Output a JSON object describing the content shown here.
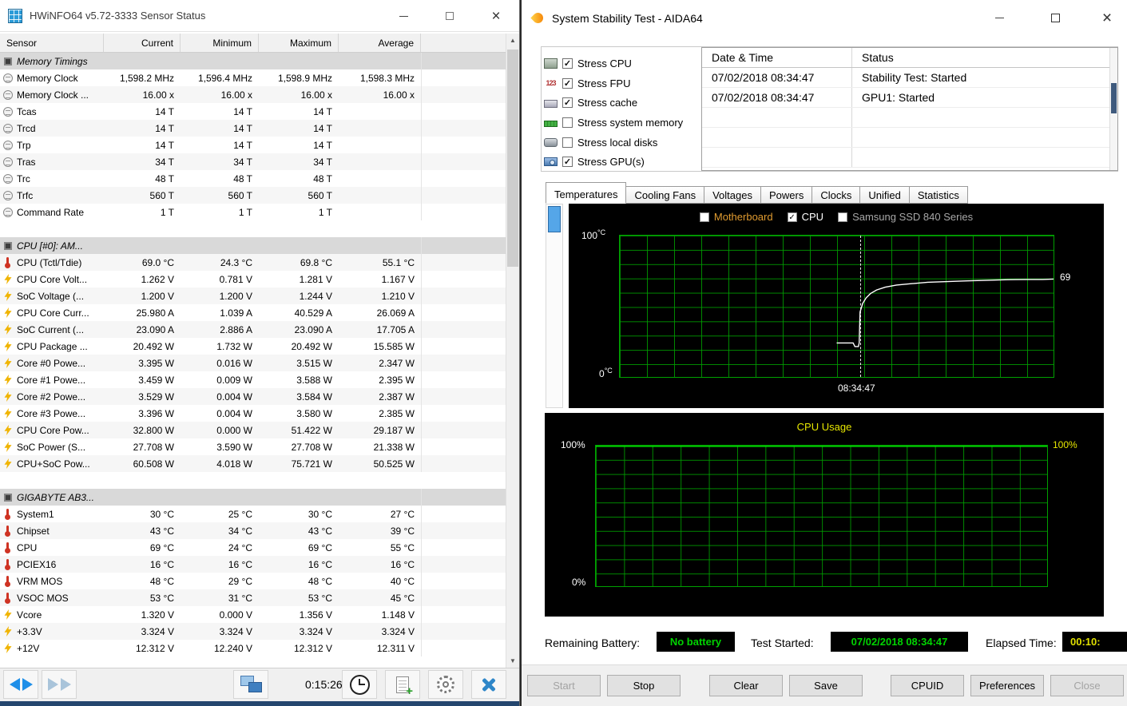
{
  "hwinfo": {
    "title": "HWiNFO64 v5.72-3333 Sensor Status",
    "columns": [
      "Sensor",
      "Current",
      "Minimum",
      "Maximum",
      "Average"
    ],
    "rows": [
      {
        "kind": "section",
        "icon": "chip-icon",
        "label": "Memory Timings"
      },
      {
        "kind": "data",
        "icon": "timing-icon",
        "label": "Memory Clock",
        "values": [
          "1,598.2 MHz",
          "1,596.4 MHz",
          "1,598.9 MHz",
          "1,598.3 MHz"
        ]
      },
      {
        "kind": "data",
        "icon": "timing-icon",
        "label": "Memory Clock ...",
        "values": [
          "16.00 x",
          "16.00 x",
          "16.00 x",
          "16.00 x"
        ]
      },
      {
        "kind": "data",
        "icon": "timing-icon",
        "label": "Tcas",
        "values": [
          "14 T",
          "14 T",
          "14 T",
          ""
        ]
      },
      {
        "kind": "data",
        "icon": "timing-icon",
        "label": "Trcd",
        "values": [
          "14 T",
          "14 T",
          "14 T",
          ""
        ]
      },
      {
        "kind": "data",
        "icon": "timing-icon",
        "label": "Trp",
        "values": [
          "14 T",
          "14 T",
          "14 T",
          ""
        ]
      },
      {
        "kind": "data",
        "icon": "timing-icon",
        "label": "Tras",
        "values": [
          "34 T",
          "34 T",
          "34 T",
          ""
        ]
      },
      {
        "kind": "data",
        "icon": "timing-icon",
        "label": "Trc",
        "values": [
          "48 T",
          "48 T",
          "48 T",
          ""
        ]
      },
      {
        "kind": "data",
        "icon": "timing-icon",
        "label": "Trfc",
        "values": [
          "560 T",
          "560 T",
          "560 T",
          ""
        ]
      },
      {
        "kind": "data",
        "icon": "timing-icon",
        "label": "Command Rate",
        "values": [
          "1 T",
          "1 T",
          "1 T",
          ""
        ]
      },
      {
        "kind": "spacer"
      },
      {
        "kind": "section",
        "icon": "chip-icon",
        "label": "CPU [#0]: AM..."
      },
      {
        "kind": "data",
        "icon": "temp-icon",
        "label": "CPU (Tctl/Tdie)",
        "values": [
          "69.0 °C",
          "24.3 °C",
          "69.8 °C",
          "55.1 °C"
        ]
      },
      {
        "kind": "data",
        "icon": "power-icon",
        "label": "CPU Core Volt...",
        "values": [
          "1.262 V",
          "0.781 V",
          "1.281 V",
          "1.167 V"
        ]
      },
      {
        "kind": "data",
        "icon": "power-icon",
        "label": "SoC Voltage (...",
        "values": [
          "1.200 V",
          "1.200 V",
          "1.244 V",
          "1.210 V"
        ]
      },
      {
        "kind": "data",
        "icon": "power-icon",
        "label": "CPU Core Curr...",
        "values": [
          "25.980 A",
          "1.039 A",
          "40.529 A",
          "26.069 A"
        ]
      },
      {
        "kind": "data",
        "icon": "power-icon",
        "label": "SoC Current (...",
        "values": [
          "23.090 A",
          "2.886 A",
          "23.090 A",
          "17.705 A"
        ]
      },
      {
        "kind": "data",
        "icon": "power-icon",
        "label": "CPU Package ...",
        "values": [
          "20.492 W",
          "1.732 W",
          "20.492 W",
          "15.585 W"
        ]
      },
      {
        "kind": "data",
        "icon": "power-icon",
        "label": "Core #0 Powe...",
        "values": [
          "3.395 W",
          "0.016 W",
          "3.515 W",
          "2.347 W"
        ]
      },
      {
        "kind": "data",
        "icon": "power-icon",
        "label": "Core #1 Powe...",
        "values": [
          "3.459 W",
          "0.009 W",
          "3.588 W",
          "2.395 W"
        ]
      },
      {
        "kind": "data",
        "icon": "power-icon",
        "label": "Core #2 Powe...",
        "values": [
          "3.529 W",
          "0.004 W",
          "3.584 W",
          "2.387 W"
        ]
      },
      {
        "kind": "data",
        "icon": "power-icon",
        "label": "Core #3 Powe...",
        "values": [
          "3.396 W",
          "0.004 W",
          "3.580 W",
          "2.385 W"
        ]
      },
      {
        "kind": "data",
        "icon": "power-icon",
        "label": "CPU Core Pow...",
        "values": [
          "32.800 W",
          "0.000 W",
          "51.422 W",
          "29.187 W"
        ]
      },
      {
        "kind": "data",
        "icon": "power-icon",
        "label": "SoC Power (S...",
        "values": [
          "27.708 W",
          "3.590 W",
          "27.708 W",
          "21.338 W"
        ]
      },
      {
        "kind": "data",
        "icon": "power-icon",
        "label": "CPU+SoC Pow...",
        "values": [
          "60.508 W",
          "4.018 W",
          "75.721 W",
          "50.525 W"
        ]
      },
      {
        "kind": "spacer"
      },
      {
        "kind": "section",
        "icon": "chip-icon",
        "label": "GIGABYTE AB3..."
      },
      {
        "kind": "data",
        "icon": "temp-icon",
        "label": "System1",
        "values": [
          "30 °C",
          "25 °C",
          "30 °C",
          "27 °C"
        ]
      },
      {
        "kind": "data",
        "icon": "temp-icon",
        "label": "Chipset",
        "values": [
          "43 °C",
          "34 °C",
          "43 °C",
          "39 °C"
        ]
      },
      {
        "kind": "data",
        "icon": "temp-icon",
        "label": "CPU",
        "values": [
          "69 °C",
          "24 °C",
          "69 °C",
          "55 °C"
        ]
      },
      {
        "kind": "data",
        "icon": "temp-icon",
        "label": "PCIEX16",
        "values": [
          "16 °C",
          "16 °C",
          "16 °C",
          "16 °C"
        ]
      },
      {
        "kind": "data",
        "icon": "temp-icon",
        "label": "VRM MOS",
        "values": [
          "48 °C",
          "29 °C",
          "48 °C",
          "40 °C"
        ]
      },
      {
        "kind": "data",
        "icon": "temp-icon",
        "label": "VSOC MOS",
        "values": [
          "53 °C",
          "31 °C",
          "53 °C",
          "45 °C"
        ]
      },
      {
        "kind": "data",
        "icon": "power-icon",
        "label": "Vcore",
        "values": [
          "1.320 V",
          "0.000 V",
          "1.356 V",
          "1.148 V"
        ]
      },
      {
        "kind": "data",
        "icon": "power-icon",
        "label": "+3.3V",
        "values": [
          "3.324 V",
          "3.324 V",
          "3.324 V",
          "3.324 V"
        ]
      },
      {
        "kind": "data",
        "icon": "power-icon",
        "label": "+12V",
        "values": [
          "12.312 V",
          "12.240 V",
          "12.312 V",
          "12.311 V"
        ]
      }
    ],
    "toolbar": {
      "elapsed": "0:15:26"
    }
  },
  "aida": {
    "title": "System Stability Test - AIDA64",
    "stress_options": [
      {
        "label": "Stress CPU",
        "checked": true,
        "icon": "cpu-icon"
      },
      {
        "label": "Stress FPU",
        "checked": true,
        "icon": "fpu-icon"
      },
      {
        "label": "Stress cache",
        "checked": true,
        "icon": "cache-icon"
      },
      {
        "label": "Stress system memory",
        "checked": false,
        "icon": "memory-icon"
      },
      {
        "label": "Stress local disks",
        "checked": false,
        "icon": "disk-icon"
      },
      {
        "label": "Stress GPU(s)",
        "checked": true,
        "icon": "gpu-icon"
      }
    ],
    "log": {
      "columns": [
        "Date & Time",
        "Status"
      ],
      "rows": [
        {
          "datetime": "07/02/2018 08:34:47",
          "status": "Stability Test: Started"
        },
        {
          "datetime": "07/02/2018 08:34:47",
          "status": "GPU1: Started"
        }
      ]
    },
    "tabs": [
      {
        "label": "Temperatures",
        "active": true
      },
      {
        "label": "Cooling Fans",
        "active": false
      },
      {
        "label": "Voltages",
        "active": false
      },
      {
        "label": "Powers",
        "active": false
      },
      {
        "label": "Clocks",
        "active": false
      },
      {
        "label": "Unified",
        "active": false
      },
      {
        "label": "Statistics",
        "active": false
      }
    ],
    "footer": {
      "battery_label": "Remaining Battery:",
      "battery_value": "No battery",
      "test_started_label": "Test Started:",
      "test_started_value": "07/02/2018 08:34:47",
      "elapsed_label": "Elapsed Time:",
      "elapsed_value": "00:10:"
    },
    "buttons": [
      {
        "label": "Start",
        "enabled": false
      },
      {
        "label": "Stop",
        "enabled": true
      },
      {
        "label": "Clear",
        "enabled": true
      },
      {
        "label": "Save",
        "enabled": true
      },
      {
        "label": "CPUID",
        "enabled": true
      },
      {
        "label": "Preferences",
        "enabled": true
      },
      {
        "label": "Close",
        "enabled": false
      }
    ]
  },
  "chart_data": [
    {
      "type": "line",
      "panel": "temperatures",
      "ylim": [
        0,
        100
      ],
      "y_top_label": "100",
      "y_bottom_label": "0",
      "y_unit": "°C",
      "x_marker_label": "08:34:47",
      "marker_x_frac": 0.553,
      "current_value_label": "69",
      "grid": true,
      "legend_position": "top",
      "legend": [
        {
          "label": "Motherboard",
          "checked": false,
          "color": "#e09b30"
        },
        {
          "label": "CPU",
          "checked": true,
          "color": "#ffffff"
        },
        {
          "label": "Samsung SSD 840 Series",
          "checked": false,
          "color": "#a8a8a8"
        }
      ],
      "series": [
        {
          "name": "CPU",
          "color": "#ffffff",
          "points": [
            [
              0.5,
              24
            ],
            [
              0.538,
              24
            ],
            [
              0.542,
              21.5
            ],
            [
              0.55,
              21.5
            ],
            [
              0.552,
              24
            ],
            [
              0.554,
              46
            ],
            [
              0.56,
              52
            ],
            [
              0.568,
              56
            ],
            [
              0.578,
              59
            ],
            [
              0.592,
              61.5
            ],
            [
              0.612,
              63.5
            ],
            [
              0.638,
              65
            ],
            [
              0.672,
              66
            ],
            [
              0.71,
              67
            ],
            [
              0.755,
              67.5
            ],
            [
              0.8,
              68
            ],
            [
              0.848,
              68.4
            ],
            [
              0.895,
              68.8
            ],
            [
              0.94,
              69
            ],
            [
              0.975,
              69
            ],
            [
              1.0,
              69.3
            ]
          ]
        }
      ]
    },
    {
      "type": "line",
      "panel": "cpu-usage",
      "title": "CPU Usage",
      "ylim": [
        0,
        100
      ],
      "y_top_label": "100%",
      "y_bottom_label": "0%",
      "right_value_label": "100%",
      "grid": true,
      "series": [
        {
          "name": "CPU Usage",
          "color": "#00dd00",
          "points": [
            [
              0,
              100
            ],
            [
              1,
              100
            ]
          ]
        }
      ]
    }
  ]
}
